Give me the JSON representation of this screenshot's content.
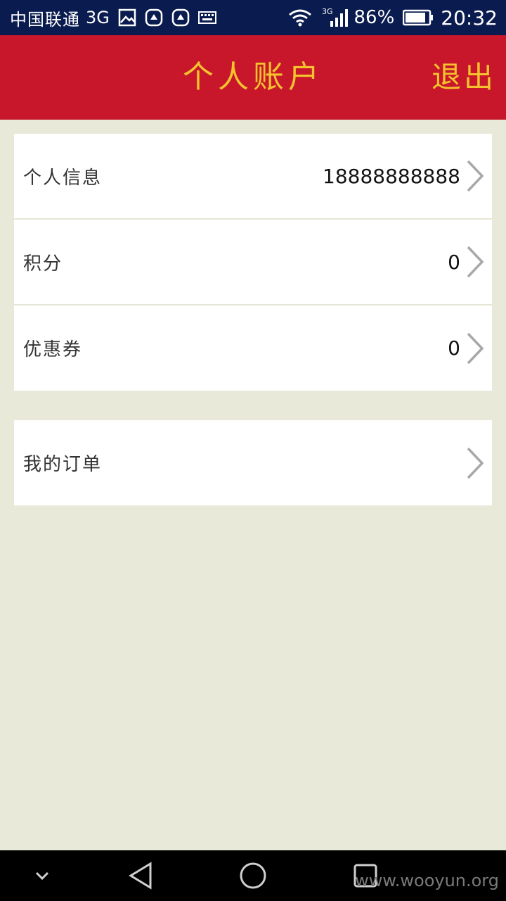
{
  "status_bar": {
    "carrier": "中国联通",
    "network": "3G",
    "signal_network": "3G",
    "battery": "86%",
    "time": "20:32",
    "icons": [
      "image-icon",
      "huawei-icon",
      "huawei-icon",
      "keyboard-icon",
      "wifi-icon",
      "signal-icon",
      "battery-icon"
    ]
  },
  "header": {
    "title": "个人账户",
    "logout": "退出",
    "bg_color": "#c8172a",
    "text_color": "#f4c32e"
  },
  "account_items": [
    {
      "label": "个人信息",
      "value": "18888888888"
    },
    {
      "label": "积分",
      "value": "0"
    },
    {
      "label": "优惠券",
      "value": "0"
    }
  ],
  "orders_item": {
    "label": "我的订单"
  },
  "nav_bar": {
    "icons": [
      "chevron-down-icon",
      "back-icon",
      "home-icon",
      "recent-apps-icon"
    ],
    "watermark": "www.wooyun.org"
  }
}
